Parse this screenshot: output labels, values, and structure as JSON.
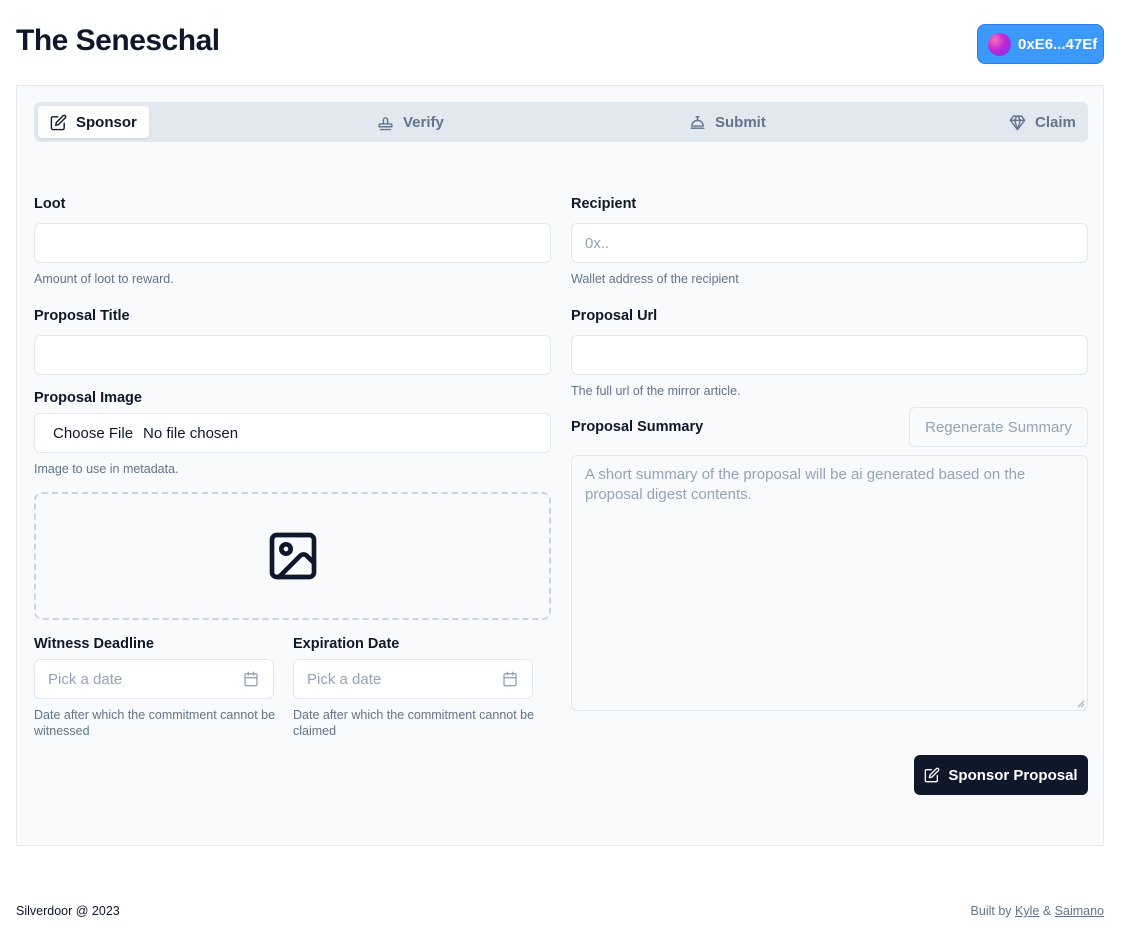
{
  "app": {
    "title": "The Seneschal"
  },
  "wallet": {
    "address": "0xE6...47Ef"
  },
  "tabs": [
    {
      "label": "Sponsor",
      "icon": "edit-icon",
      "active": true
    },
    {
      "label": "Verify",
      "icon": "stamp-icon",
      "active": false
    },
    {
      "label": "Submit",
      "icon": "bell-icon",
      "active": false
    },
    {
      "label": "Claim",
      "icon": "gem-icon",
      "active": false
    }
  ],
  "form": {
    "loot": {
      "label": "Loot",
      "value": "",
      "help": "Amount of loot to reward."
    },
    "recipient": {
      "label": "Recipient",
      "placeholder": "0x..",
      "help": "Wallet address of the recipient"
    },
    "proposal_title": {
      "label": "Proposal Title",
      "value": ""
    },
    "proposal_url": {
      "label": "Proposal Url",
      "value": "",
      "help": "The full url of the mirror article."
    },
    "proposal_image": {
      "label": "Proposal Image",
      "choose_label": "Choose File",
      "file_status": "No file chosen",
      "help": "Image to use in metadata."
    },
    "proposal_summary": {
      "label": "Proposal Summary",
      "regenerate_label": "Regenerate Summary",
      "placeholder": "A short summary of the proposal will be ai generated based on the proposal digest contents."
    },
    "witness_deadline": {
      "label": "Witness Deadline",
      "placeholder": "Pick a date",
      "help": "Date after which the commitment cannot be witnessed"
    },
    "expiration_date": {
      "label": "Expiration Date",
      "placeholder": "Pick a date",
      "help": "Date after which the commitment cannot be claimed"
    },
    "submit_label": "Sponsor Proposal"
  },
  "footer": {
    "left": "Silverdoor @ 2023",
    "built_by": "Built by",
    "author1": "Kyle",
    "amp": "&",
    "author2": "Saimano"
  },
  "colors": {
    "accent": "#3b99fc",
    "primary_button": "#0f172a",
    "card_bg": "#f8fafc",
    "tabs_bg": "#e2e8f0"
  }
}
